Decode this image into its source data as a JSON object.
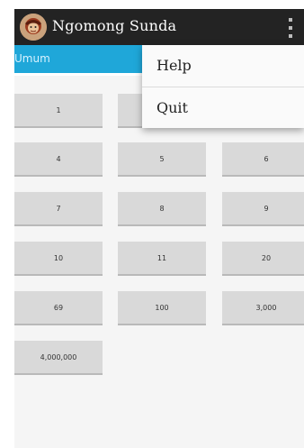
{
  "app": {
    "title": "Ngomong Sunda",
    "icon": "character-avatar-icon",
    "overflow_icon": "overflow-menu-icon"
  },
  "tabs": [
    {
      "label": "Umum",
      "selected": true
    }
  ],
  "numbers": [
    "1",
    "4",
    "5",
    "6",
    "7",
    "8",
    "9",
    "10",
    "11",
    "20",
    "69",
    "100",
    "3,000",
    "4,000,000"
  ],
  "menu": {
    "items": [
      "Help",
      "Quit"
    ]
  },
  "colors": {
    "actionbar": "#232323",
    "tabbar": "#1fa7d9",
    "button": "#d9d9d9"
  }
}
